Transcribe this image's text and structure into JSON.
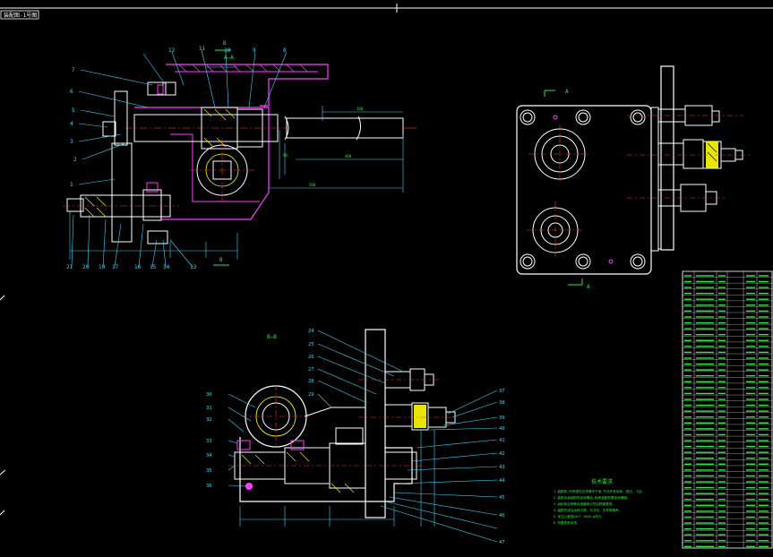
{
  "title_block_tab": "装配图-1号图",
  "views": {
    "section_b_label": "B",
    "section_aa_label": "A—A",
    "section_b_bottom": "B",
    "view_a_label": "A",
    "view_a_bottom": "A",
    "section_bb_label": "B—B"
  },
  "callouts_left": [
    "7",
    "6",
    "5",
    "4",
    "3",
    "2",
    "1",
    "21",
    "20",
    "19",
    "17",
    "16",
    "15",
    "14",
    "13",
    "12",
    "11",
    "10",
    "9",
    "8"
  ],
  "callouts_bottom_view_right": [
    "24",
    "25",
    "26",
    "27",
    "28",
    "29",
    "30",
    "31",
    "32",
    "33",
    "34",
    "35",
    "36",
    "37"
  ],
  "callouts_bottom_view_left": [
    "38",
    "39",
    "40",
    "41",
    "42",
    "43",
    "44",
    "45",
    "46",
    "47"
  ],
  "tech_req_title": "技术要求",
  "tech_req_lines": [
    "1.装配前,所有零件必须清洗干净,不允许有毛刺、锐边、飞边。",
    "2.各配合面装配时涂润滑油,轴承装配前需加润滑脂。",
    "3.齿轮啮合侧隙及接触斑点符合精度要求。",
    "4.装配完成后运转平稳、无冲击、无异常噪声。",
    "5.未注公差按GB/T 1804-m执行。",
    "6.外露表面涂漆。"
  ],
  "bom_rows": 47,
  "colors": {
    "background": "#000000",
    "outline": "#ffffff",
    "section": "#ff3cff",
    "dimension": "#39d9ff",
    "text": "#2eea3e",
    "hatch": "#ffff00",
    "center": "#ff3030"
  }
}
